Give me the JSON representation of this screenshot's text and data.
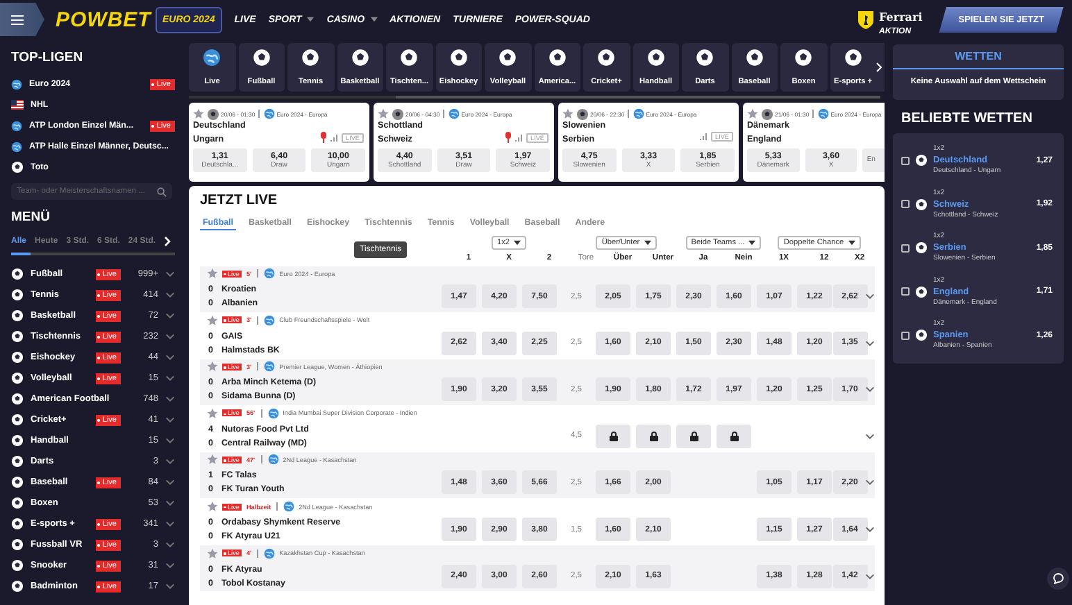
{
  "header": {
    "logo": "POWBET",
    "nav": [
      {
        "label": "EURO 2024",
        "kind": "boxed"
      },
      {
        "label": "LIVE",
        "kind": "plain"
      },
      {
        "label": "SPORT",
        "kind": "dropdown"
      },
      {
        "label": "CASINO",
        "kind": "dropdown"
      },
      {
        "label": "AKTIONEN",
        "kind": "plain"
      },
      {
        "label": "TURNIERE",
        "kind": "plain"
      },
      {
        "label": "POWER-SQUAD",
        "kind": "plain"
      }
    ],
    "promo_brand": "Ferrari",
    "promo_label": "AKTION",
    "cta": "SPIELEN SIE JETZT"
  },
  "top_leagues": {
    "title": "TOP-LIGEN",
    "items": [
      {
        "name": "Euro 2024",
        "badge": "Live"
      },
      {
        "name": "NHL"
      },
      {
        "name": "ATP London Einzel Män...",
        "badge": "Live"
      },
      {
        "name": "ATP Halle Einzel Männer, Deutsc..."
      },
      {
        "name": "Toto"
      }
    ],
    "search": {
      "placeholder": "Team- oder Meisterschaftsnamen ..."
    }
  },
  "menu": {
    "title": "MENÜ",
    "filters": [
      {
        "label": "Alle",
        "selected": true
      },
      {
        "label": "Heute",
        "selected": false
      },
      {
        "label": "3 Std.",
        "selected": false
      },
      {
        "label": "6 Std.",
        "selected": false
      },
      {
        "label": "24 Std.",
        "selected": false
      }
    ],
    "sports": [
      {
        "name": "Fußball",
        "badge": "Live",
        "count": "999+"
      },
      {
        "name": "Tennis",
        "badge": "Live",
        "count": "414"
      },
      {
        "name": "Basketball",
        "badge": "Live",
        "count": "72"
      },
      {
        "name": "Tischtennis",
        "badge": "Live",
        "count": "232"
      },
      {
        "name": "Eishockey",
        "badge": "Live",
        "count": "44"
      },
      {
        "name": "Volleyball",
        "badge": "Live",
        "count": "15"
      },
      {
        "name": "American Football",
        "count": "748"
      },
      {
        "name": "Cricket+",
        "badge": "Live",
        "count": "41"
      },
      {
        "name": "Handball",
        "count": "15"
      },
      {
        "name": "Darts",
        "count": "3"
      },
      {
        "name": "Baseball",
        "badge": "Live",
        "count": "84"
      },
      {
        "name": "Boxen",
        "count": "53"
      },
      {
        "name": "E-sports +",
        "badge": "Live",
        "count": "341"
      },
      {
        "name": "Fussball VR",
        "badge": "Live",
        "count": "3"
      },
      {
        "name": "Snooker",
        "badge": "Live",
        "count": "31"
      },
      {
        "name": "Badminton",
        "badge": "Live",
        "count": "17"
      }
    ]
  },
  "sport_tiles": [
    "Live",
    "Fußball",
    "Tennis",
    "Basketball",
    "Tischten...",
    "Eishockey",
    "Volleyball",
    "America...",
    "Cricket+",
    "Handball",
    "Darts",
    "Baseball",
    "Boxen",
    "E-sports +"
  ],
  "match_cards": [
    {
      "time": "20/06 - 01:30",
      "league": "Euro 2024 - Europa",
      "home": "Deutschland",
      "away": "Ungarn",
      "stream": true,
      "live_label": "LIVE",
      "odds": [
        {
          "value": "1,31",
          "label": "Deutschla..."
        },
        {
          "value": "6,40",
          "label": "Draw"
        },
        {
          "value": "10,00",
          "label": "Ungarn"
        }
      ]
    },
    {
      "time": "20/06 - 04:30",
      "league": "Euro 2024 - Europa",
      "home": "Schottland",
      "away": "Schweiz",
      "stream": true,
      "live_label": "LIVE",
      "odds": [
        {
          "value": "4,40",
          "label": "Schottland"
        },
        {
          "value": "3,51",
          "label": "Draw"
        },
        {
          "value": "1,97",
          "label": "Schweiz"
        }
      ]
    },
    {
      "time": "20/06 - 22:30",
      "league": "Euro 2024 - Europa",
      "home": "Slowenien",
      "away": "Serbien",
      "stream": false,
      "live_label": "LIVE",
      "odds": [
        {
          "value": "4,75",
          "label": "Slowenien"
        },
        {
          "value": "3,33",
          "label": "X"
        },
        {
          "value": "1,85",
          "label": "Serbien"
        }
      ]
    },
    {
      "time": "21/06 - 01:30",
      "league": "Euro 2024 - Europa",
      "home": "Dänemark",
      "away": "England",
      "stream": false,
      "odds": [
        {
          "value": "5,33",
          "label": "Dänemark"
        },
        {
          "value": "3,60",
          "label": "X"
        },
        {
          "label": "En"
        }
      ]
    }
  ],
  "live_section": {
    "title": "JETZT LIVE",
    "tabs": [
      {
        "label": "Fußball",
        "selected": true
      },
      {
        "label": "Basketball",
        "selected": false
      },
      {
        "label": "Eishockey",
        "selected": false
      },
      {
        "label": "Tischtennis",
        "selected": false
      },
      {
        "label": "Tennis",
        "selected": false
      },
      {
        "label": "Volleyball",
        "selected": false
      },
      {
        "label": "Baseball",
        "selected": false
      },
      {
        "label": "Andere",
        "selected": false
      }
    ],
    "tooltip": "Tischtennis",
    "markets": [
      "1x2",
      "Über/Unter",
      "Beide Teams ...",
      "Doppelte Chance"
    ],
    "columns": [
      "1",
      "X",
      "2",
      "Tore",
      "Über",
      "Unter",
      "Ja",
      "Nein",
      "1X",
      "12",
      "X2"
    ],
    "matches": [
      {
        "badge": "Live",
        "minute": "5'",
        "league": "Euro 2024 - Europa",
        "home_score": "0",
        "home": "Kroatien",
        "away_score": "0",
        "away": "Albanien",
        "cells": [
          {
            "kind": "odd",
            "value": "1,47"
          },
          {
            "kind": "odd",
            "value": "4,20"
          },
          {
            "kind": "odd",
            "value": "7,50"
          },
          {
            "kind": "line",
            "value": "2,5"
          },
          {
            "kind": "odd",
            "value": "2,05"
          },
          {
            "kind": "odd",
            "value": "1,75"
          },
          {
            "kind": "odd",
            "value": "2,30"
          },
          {
            "kind": "odd",
            "value": "1,60"
          },
          {
            "kind": "odd",
            "value": "1,07"
          },
          {
            "kind": "odd",
            "value": "1,22"
          },
          {
            "kind": "odd",
            "value": "2,62"
          }
        ]
      },
      {
        "badge": "Live",
        "minute": "3'",
        "league": "Club Freundschaftsspiele - Welt",
        "home_score": "0",
        "home": "GAIS",
        "away_score": "0",
        "away": "Halmstads BK",
        "cells": [
          {
            "kind": "odd",
            "value": "2,62"
          },
          {
            "kind": "odd",
            "value": "3,40"
          },
          {
            "kind": "odd",
            "value": "2,25"
          },
          {
            "kind": "line",
            "value": "2,5"
          },
          {
            "kind": "odd",
            "value": "1,60"
          },
          {
            "kind": "odd",
            "value": "2,10"
          },
          {
            "kind": "odd",
            "value": "1,50"
          },
          {
            "kind": "odd",
            "value": "2,30"
          },
          {
            "kind": "odd",
            "value": "1,48"
          },
          {
            "kind": "odd",
            "value": "1,20"
          },
          {
            "kind": "odd",
            "value": "1,35"
          }
        ]
      },
      {
        "badge": "Live",
        "minute": "3'",
        "league": "Premier League, Women - Äthiopien",
        "home_score": "0",
        "home": "Arba Minch Ketema (D)",
        "away_score": "0",
        "away": "Sidama Bunna (D)",
        "cells": [
          {
            "kind": "odd",
            "value": "1,90"
          },
          {
            "kind": "odd",
            "value": "3,20"
          },
          {
            "kind": "odd",
            "value": "3,55"
          },
          {
            "kind": "line",
            "value": "2,5"
          },
          {
            "kind": "odd",
            "value": "1,90"
          },
          {
            "kind": "odd",
            "value": "1,80"
          },
          {
            "kind": "odd",
            "value": "1,72"
          },
          {
            "kind": "odd",
            "value": "1,97"
          },
          {
            "kind": "odd",
            "value": "1,20"
          },
          {
            "kind": "odd",
            "value": "1,25"
          },
          {
            "kind": "odd",
            "value": "1,70"
          }
        ]
      },
      {
        "badge": "Live",
        "minute": "56'",
        "league": "India Mumbai Super Division Corporate - Indien",
        "home_score": "4",
        "home": "Nutoras Food Pvt Ltd",
        "away_score": "0",
        "away": "Central Railway (MD)",
        "cells": [
          {
            "kind": "empty"
          },
          {
            "kind": "empty"
          },
          {
            "kind": "empty"
          },
          {
            "kind": "line",
            "value": "4,5"
          },
          {
            "kind": "lock"
          },
          {
            "kind": "lock"
          },
          {
            "kind": "lock"
          },
          {
            "kind": "lock"
          },
          {
            "kind": "empty"
          },
          {
            "kind": "empty"
          },
          {
            "kind": "empty"
          }
        ]
      },
      {
        "badge": "Live",
        "minute": "47'",
        "league": "2Nd League - Kasachstan",
        "home_score": "1",
        "home": "FC Talas",
        "away_score": "0",
        "away": "FK Turan Youth",
        "cells": [
          {
            "kind": "odd",
            "value": "1,48"
          },
          {
            "kind": "odd",
            "value": "3,60"
          },
          {
            "kind": "odd",
            "value": "5,66"
          },
          {
            "kind": "line",
            "value": "2,5"
          },
          {
            "kind": "odd",
            "value": "1,66"
          },
          {
            "kind": "odd",
            "value": "2,00"
          },
          {
            "kind": "empty"
          },
          {
            "kind": "empty"
          },
          {
            "kind": "odd",
            "value": "1,05"
          },
          {
            "kind": "odd",
            "value": "1,17"
          },
          {
            "kind": "odd",
            "value": "2,20"
          }
        ]
      },
      {
        "badge": "Live",
        "minute": "Halbzeit",
        "league": "2Nd League - Kasachstan",
        "home_score": "0",
        "home": "Ordabasy Shymkent Reserve",
        "away_score": "0",
        "away": "FK Atyrau U21",
        "cells": [
          {
            "kind": "odd",
            "value": "1,90"
          },
          {
            "kind": "odd",
            "value": "2,90"
          },
          {
            "kind": "odd",
            "value": "3,80"
          },
          {
            "kind": "line",
            "value": "1,5"
          },
          {
            "kind": "odd",
            "value": "1,60"
          },
          {
            "kind": "odd",
            "value": "2,10"
          },
          {
            "kind": "empty"
          },
          {
            "kind": "empty"
          },
          {
            "kind": "odd",
            "value": "1,15"
          },
          {
            "kind": "odd",
            "value": "1,27"
          },
          {
            "kind": "odd",
            "value": "1,64"
          }
        ]
      },
      {
        "badge": "Live",
        "minute": "4'",
        "league": "Kazakhstan Cup - Kasachstan",
        "home_score": "0",
        "home": "FK Atyrau",
        "away_score": "0",
        "away": "Tobol Kostanay",
        "cells": [
          {
            "kind": "odd",
            "value": "2,40"
          },
          {
            "kind": "odd",
            "value": "3,00"
          },
          {
            "kind": "odd",
            "value": "2,60"
          },
          {
            "kind": "line",
            "value": "2,5"
          },
          {
            "kind": "odd",
            "value": "2,10"
          },
          {
            "kind": "odd",
            "value": "1,63"
          },
          {
            "kind": "empty"
          },
          {
            "kind": "empty"
          },
          {
            "kind": "odd",
            "value": "1,38"
          },
          {
            "kind": "odd",
            "value": "1,28"
          },
          {
            "kind": "odd",
            "value": "1,42"
          }
        ]
      }
    ]
  },
  "betslip": {
    "tab": "WETTEN",
    "empty_text": "Keine Auswahl auf dem Wettschein"
  },
  "popular_bets": {
    "title": "BELIEBTE WETTEN",
    "items": [
      {
        "market": "1x2",
        "pick": "Deutschland",
        "match": "Deutschland - Ungarn",
        "odd": "1,27",
        "checked": false
      },
      {
        "market": "1x2",
        "pick": "Schweiz",
        "match": "Schottland - Schweiz",
        "odd": "1,92",
        "checked": false
      },
      {
        "market": "1x2",
        "pick": "Serbien",
        "match": "Slowenien - Serbien",
        "odd": "1,85",
        "checked": false
      },
      {
        "market": "1x2",
        "pick": "England",
        "match": "Dänemark - England",
        "odd": "1,71",
        "checked": false
      },
      {
        "market": "1x2",
        "pick": "Spanien",
        "match": "Albanien - Spanien",
        "odd": "1,26",
        "checked": false
      }
    ]
  }
}
